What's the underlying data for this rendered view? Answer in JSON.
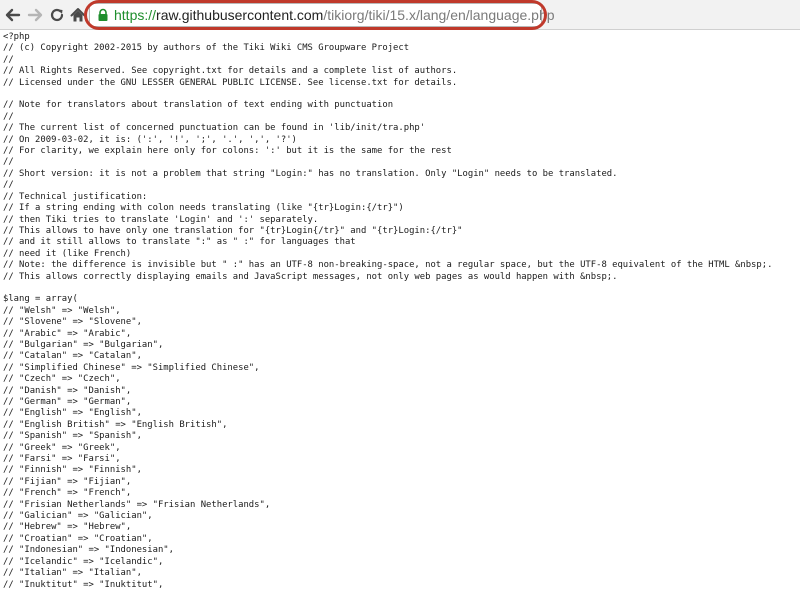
{
  "browser": {
    "url_scheme": "https://",
    "url_host": "raw.githubusercontent.com",
    "url_path": "/tikiorg/tiki/15.x/lang/en/language.php",
    "icons": {
      "back": "arrow-left-icon",
      "forward": "arrow-right-icon",
      "reload": "reload-icon",
      "home": "home-icon",
      "secure": "lock-icon"
    },
    "accent_colors": {
      "secure_scheme": "#1f8e2d",
      "highlight": "#c0392b"
    }
  },
  "source_lines": [
    "<?php",
    "// (c) Copyright 2002-2015 by authors of the Tiki Wiki CMS Groupware Project",
    "//",
    "// All Rights Reserved. See copyright.txt for details and a complete list of authors.",
    "// Licensed under the GNU LESSER GENERAL PUBLIC LICENSE. See license.txt for details.",
    "",
    "// Note for translators about translation of text ending with punctuation",
    "//",
    "// The current list of concerned punctuation can be found in 'lib/init/tra.php'",
    "// On 2009-03-02, it is: (':', '!', ';', '.', ',', '?')",
    "// For clarity, we explain here only for colons: ':' but it is the same for the rest",
    "//",
    "// Short version: it is not a problem that string \"Login:\" has no translation. Only \"Login\" needs to be translated.",
    "//",
    "// Technical justification:",
    "// If a string ending with colon needs translating (like \"{tr}Login:{/tr}\")",
    "// then Tiki tries to translate 'Login' and ':' separately.",
    "// This allows to have only one translation for \"{tr}Login{/tr}\" and \"{tr}Login:{/tr}\"",
    "// and it still allows to translate \":\" as \" :\" for languages that",
    "// need it (like French)",
    "// Note: the difference is invisible but \" :\" has an UTF-8 non-breaking-space, not a regular space, but the UTF-8 equivalent of the HTML &nbsp;.",
    "// This allows correctly displaying emails and JavaScript messages, not only web pages as would happen with &nbsp;.",
    "",
    "$lang = array(",
    "// \"Welsh\" => \"Welsh\",",
    "// \"Slovene\" => \"Slovene\",",
    "// \"Arabic\" => \"Arabic\",",
    "// \"Bulgarian\" => \"Bulgarian\",",
    "// \"Catalan\" => \"Catalan\",",
    "// \"Simplified Chinese\" => \"Simplified Chinese\",",
    "// \"Czech\" => \"Czech\",",
    "// \"Danish\" => \"Danish\",",
    "// \"German\" => \"German\",",
    "// \"English\" => \"English\",",
    "// \"English British\" => \"English British\",",
    "// \"Spanish\" => \"Spanish\",",
    "// \"Greek\" => \"Greek\",",
    "// \"Farsi\" => \"Farsi\",",
    "// \"Finnish\" => \"Finnish\",",
    "// \"Fijian\" => \"Fijian\",",
    "// \"French\" => \"French\",",
    "// \"Frisian Netherlands\" => \"Frisian Netherlands\",",
    "// \"Galician\" => \"Galician\",",
    "// \"Hebrew\" => \"Hebrew\",",
    "// \"Croatian\" => \"Croatian\",",
    "// \"Indonesian\" => \"Indonesian\",",
    "// \"Icelandic\" => \"Icelandic\",",
    "// \"Italian\" => \"Italian\",",
    "// \"Inuktitut\" => \"Inuktitut\","
  ]
}
